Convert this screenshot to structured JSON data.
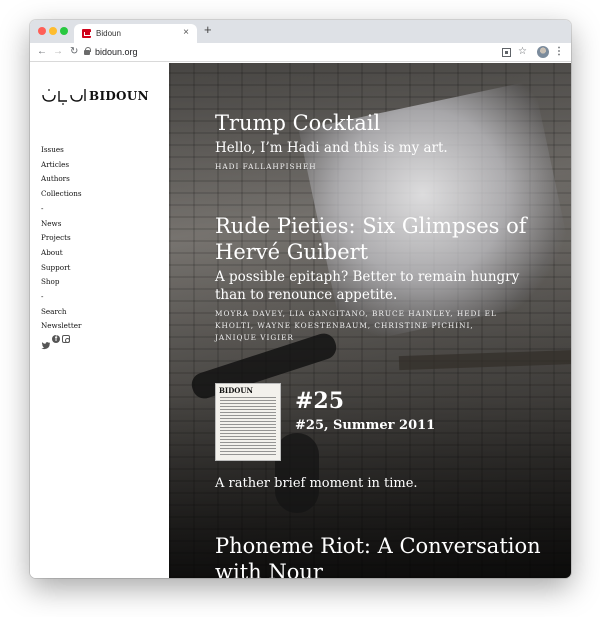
{
  "browser": {
    "tab_title": "Bidoun",
    "tab_close": "×",
    "new_tab": "+",
    "url": "bidoun.org",
    "back": "←",
    "forward": "→",
    "reload": "↻",
    "star": "☆",
    "menu": "⋮"
  },
  "sidebar": {
    "logo_text": "BIDOUN",
    "nav_items": [
      "Issues",
      "Articles",
      "Authors",
      "Collections",
      "-",
      "News",
      "Projects",
      "About",
      "Support",
      "Shop",
      "-",
      "Search",
      "Newsletter"
    ],
    "social": {
      "facebook_glyph": "f"
    }
  },
  "articles": [
    {
      "title": "Trump Cocktail",
      "subtitle": "Hello, I’m Hadi and this is my art.",
      "authors": "Hadi Fallahpisheh"
    },
    {
      "title": "Rude Pieties: Six Glimpses of Hervé Guibert",
      "subtitle": "A possible epitaph? Better to remain hungry than to renounce appetite.",
      "authors": "Moyra Davey, Lia Gangitano, Bruce Hainley, Hedi El Kholti, Wayne Koestenbaum, Christine Pichini, Janique Vigier"
    },
    {
      "title": "Phoneme Riot: A Conversation with Nour"
    }
  ],
  "issue": {
    "cover_logo": "BIDOUN",
    "number": "#25",
    "season": "#25, Summer 2011",
    "description": "A rather brief moment in time."
  }
}
